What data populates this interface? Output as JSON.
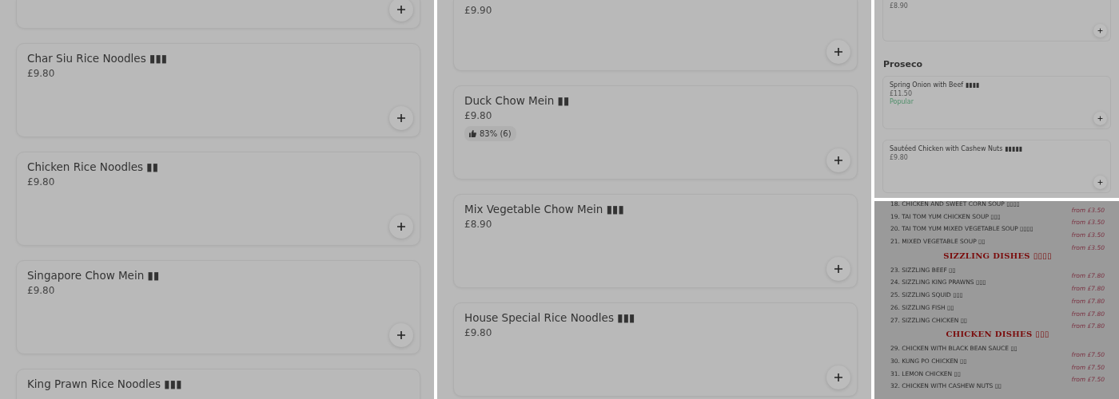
{
  "columns": [
    {
      "panels": [
        {
          "kind": "cards",
          "blocks": [
            {
              "kind": "card",
              "partial": true
            },
            {
              "kind": "card",
              "partial": false,
              "name": "Char Siu Rice Noodles ▮▮▮",
              "price": "£9.80"
            },
            {
              "kind": "card",
              "partial": false,
              "name": "Chicken Rice Noodles ▮▮",
              "price": "£9.80"
            },
            {
              "kind": "card",
              "partial": false,
              "name": "Singapore Chow Mein ▮▮",
              "price": "£9.80"
            },
            {
              "kind": "card",
              "partial": false,
              "name": "King Prawn Rice Noodles ▮▮▮"
            }
          ]
        }
      ]
    },
    {
      "panels": [
        {
          "kind": "cards",
          "blocks": [
            {
              "kind": "card",
              "partial": true,
              "price": "£9.90"
            },
            {
              "kind": "card",
              "partial": false,
              "name": "Duck Chow Mein ▮▮",
              "price": "£9.80",
              "rating": "83% (6)"
            },
            {
              "kind": "card",
              "partial": false,
              "name": "Mix Vegetable Chow Mein ▮▮▮",
              "price": "£8.90"
            },
            {
              "kind": "card",
              "partial": false,
              "name": "House Special Rice Noodles ▮▮▮",
              "price": "£9.80"
            }
          ]
        }
      ]
    },
    {
      "panels": [
        {
          "kind": "mobile_cards",
          "blocks": [
            {
              "kind": "card",
              "partial": true,
              "price": "£8.90"
            },
            {
              "kind": "heading",
              "text": "Proseco"
            },
            {
              "kind": "card",
              "partial": false,
              "name": "Spring Onion with Beef ▮▮▮▮",
              "price": "£11.50",
              "tag": "Popular"
            },
            {
              "kind": "card",
              "partial": false,
              "name": "Sautéed Chicken with Cashew Nuts ▮▮▮▮▮",
              "price": "£9.80"
            }
          ]
        },
        {
          "kind": "printed_menu",
          "lines": [
            {
              "kind": "item",
              "name": "18. CHICKEN AND SWEET CORN SOUP ▯▯▯▯",
              "price": "from £3.50"
            },
            {
              "kind": "item",
              "name": "19. TAI TOM YUM CHICKEN SOUP ▯▯▯",
              "price": "from £3.50"
            },
            {
              "kind": "item",
              "name": "20. TAI TOM YUM MIXED VEGETABLE SOUP ▯▯▯▯",
              "price": "from £3.50"
            },
            {
              "kind": "item",
              "name": "21. MIXED VEGETABLE SOUP ▯▯",
              "price": "from £3.50"
            },
            {
              "kind": "heading",
              "text": "SIZZLING DISHES ▯▯▯▯"
            },
            {
              "kind": "item",
              "name": "23. SIZZLING BEEF ▯▯",
              "price": "from £7.80"
            },
            {
              "kind": "item",
              "name": "24. SIZZLING KING PRAWNS ▯▯▯",
              "price": "from £7.80"
            },
            {
              "kind": "item",
              "name": "25. SIZZLING SQUID ▯▯▯",
              "price": "from £7.80"
            },
            {
              "kind": "item",
              "name": "26. SIZZLING FISH ▯▯",
              "price": "from £7.80"
            },
            {
              "kind": "item",
              "name": "27. SIZZLING CHICKEN ▯▯",
              "price": "from £7.80"
            },
            {
              "kind": "heading",
              "text": "CHICKEN DISHES ▯▯▯"
            },
            {
              "kind": "item",
              "name": "29. CHICKEN WITH BLACK BEAN SAUCE ▯▯",
              "price": "from £7.50"
            },
            {
              "kind": "item",
              "name": "30. KUNG PO CHICKEN ▯▯",
              "price": "from £7.50"
            },
            {
              "kind": "item",
              "name": "31. LEMON CHICKEN ▯▯",
              "price": "from £7.50"
            },
            {
              "kind": "item",
              "name": "32. CHICKEN WITH CASHEW NUTS ▯▯"
            }
          ]
        }
      ]
    }
  ]
}
